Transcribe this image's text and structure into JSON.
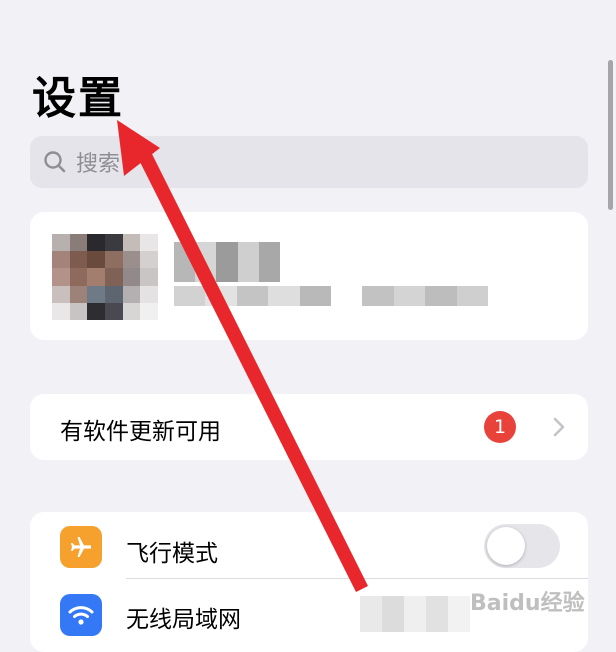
{
  "header": {
    "title": "设置"
  },
  "search": {
    "placeholder": "搜索",
    "icon": "magnifying-glass"
  },
  "profile": {
    "avatar": "pixelated-avatar"
  },
  "update_row": {
    "label": "有软件更新可用",
    "badge_count": "1",
    "chevron": "chevron-right"
  },
  "settings": {
    "items": [
      {
        "label": "飞行模式",
        "icon": "airplane",
        "icon_color": "#f6a02d",
        "toggle_on": false
      },
      {
        "label": "无线局域网",
        "icon": "wifi",
        "icon_color": "#3478f6"
      }
    ]
  },
  "watermark": {
    "text": "Baidu经验"
  },
  "colors": {
    "background": "#f2f2f6",
    "card": "#ffffff",
    "badge": "#e8423a",
    "annotation_arrow": "#e8272d"
  }
}
